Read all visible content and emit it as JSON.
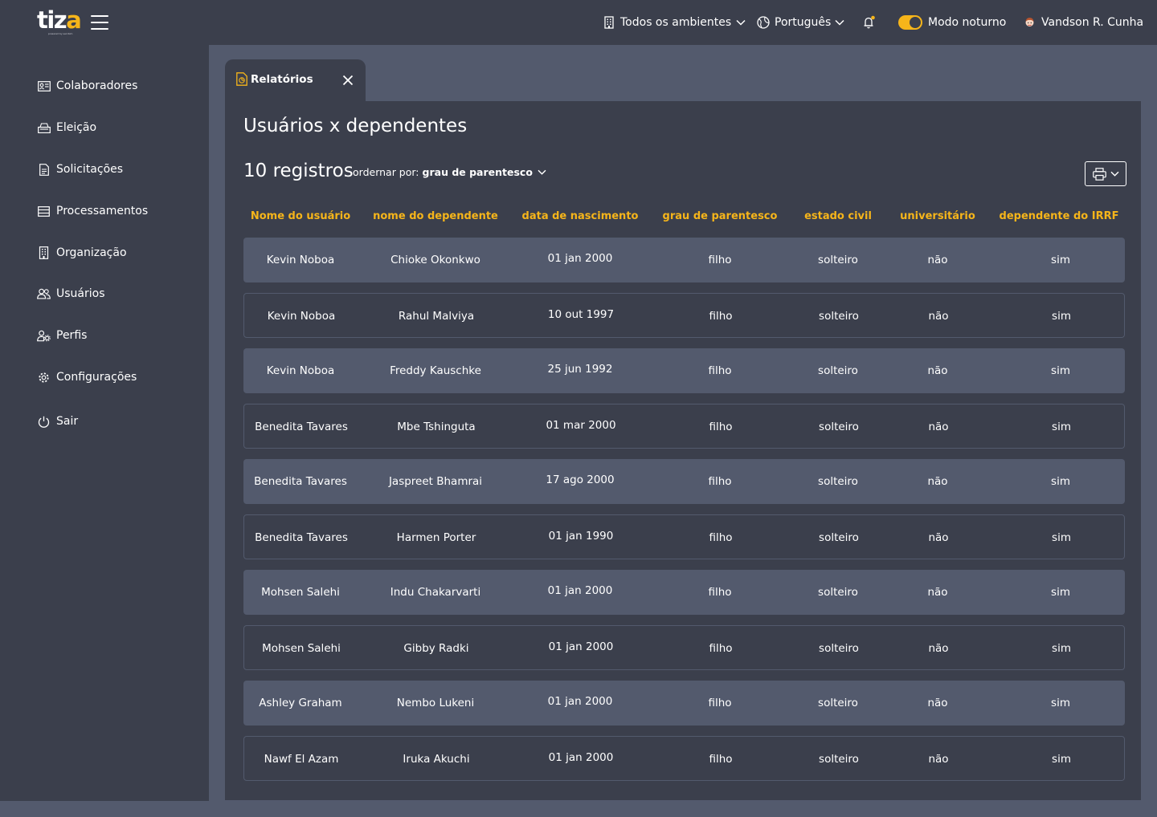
{
  "header": {
    "logo_main": "tiz",
    "logo_accent": "a",
    "logo_sub": "powered by sercbim",
    "environment": "Todos os ambientes",
    "language": "Português",
    "night_mode": "Modo noturno",
    "user": "Vandson R. Cunha"
  },
  "sidebar": {
    "items": [
      {
        "label": "Colaboradores",
        "icon": "id-card-icon"
      },
      {
        "label": "Eleição",
        "icon": "ballot-box-icon"
      },
      {
        "label": "Solicitações",
        "icon": "document-icon"
      },
      {
        "label": "Processamentos",
        "icon": "list-icon"
      },
      {
        "label": "Organização",
        "icon": "building-icon"
      },
      {
        "label": "Usuários",
        "icon": "users-icon"
      },
      {
        "label": "Perfis",
        "icon": "user-settings-icon"
      },
      {
        "label": "Configurações",
        "icon": "gear-icon"
      },
      {
        "label": "Sair",
        "icon": "power-icon"
      }
    ]
  },
  "tab": {
    "label": "Relatórios"
  },
  "report": {
    "title": "Usuários x dependentes",
    "count_label": "10 registros",
    "sort_prefix": "ordernar por:",
    "sort_value": "grau de parentesco"
  },
  "table": {
    "columns": [
      "Nome do usuário",
      "nome do dependente",
      "data de nascimento",
      "grau de parentesco",
      "estado civil",
      "universitário",
      "dependente do IRRF"
    ],
    "rows": [
      [
        "Kevin Noboa",
        "Chioke Okonkwo",
        "01 jan 2000",
        "filho",
        "solteiro",
        "não",
        "sim"
      ],
      [
        "Kevin Noboa",
        "Rahul Malviya",
        "10 out 1997",
        "filho",
        "solteiro",
        "não",
        "sim"
      ],
      [
        "Kevin Noboa",
        "Freddy Kauschke",
        "25 jun 1992",
        "filho",
        "solteiro",
        "não",
        "sim"
      ],
      [
        "Benedita Tavares",
        "Mbe Tshinguta",
        "01 mar 2000",
        "filho",
        "solteiro",
        "não",
        "sim"
      ],
      [
        "Benedita Tavares",
        "Jaspreet Bhamrai",
        "17 ago 2000",
        "filho",
        "solteiro",
        "não",
        "sim"
      ],
      [
        "Benedita Tavares",
        "Harmen Porter",
        "01 jan 1990",
        "filho",
        "solteiro",
        "não",
        "sim"
      ],
      [
        "Mohsen Salehi",
        "Indu Chakarvarti",
        "01 jan 2000",
        "filho",
        "solteiro",
        "não",
        "sim"
      ],
      [
        "Mohsen Salehi",
        "Gibby Radki",
        "01 jan 2000",
        "filho",
        "solteiro",
        "não",
        "sim"
      ],
      [
        "Ashley Graham",
        "Nembo Lukeni",
        "01 jan 2000",
        "filho",
        "solteiro",
        "não",
        "sim"
      ],
      [
        "Nawf El Azam",
        "Iruka Akuchi",
        "01 jan 2000",
        "filho",
        "solteiro",
        "não",
        "sim"
      ]
    ]
  },
  "colors": {
    "accent": "#f6b51a",
    "background": "#535a6d",
    "panel": "#3b3f4c"
  }
}
